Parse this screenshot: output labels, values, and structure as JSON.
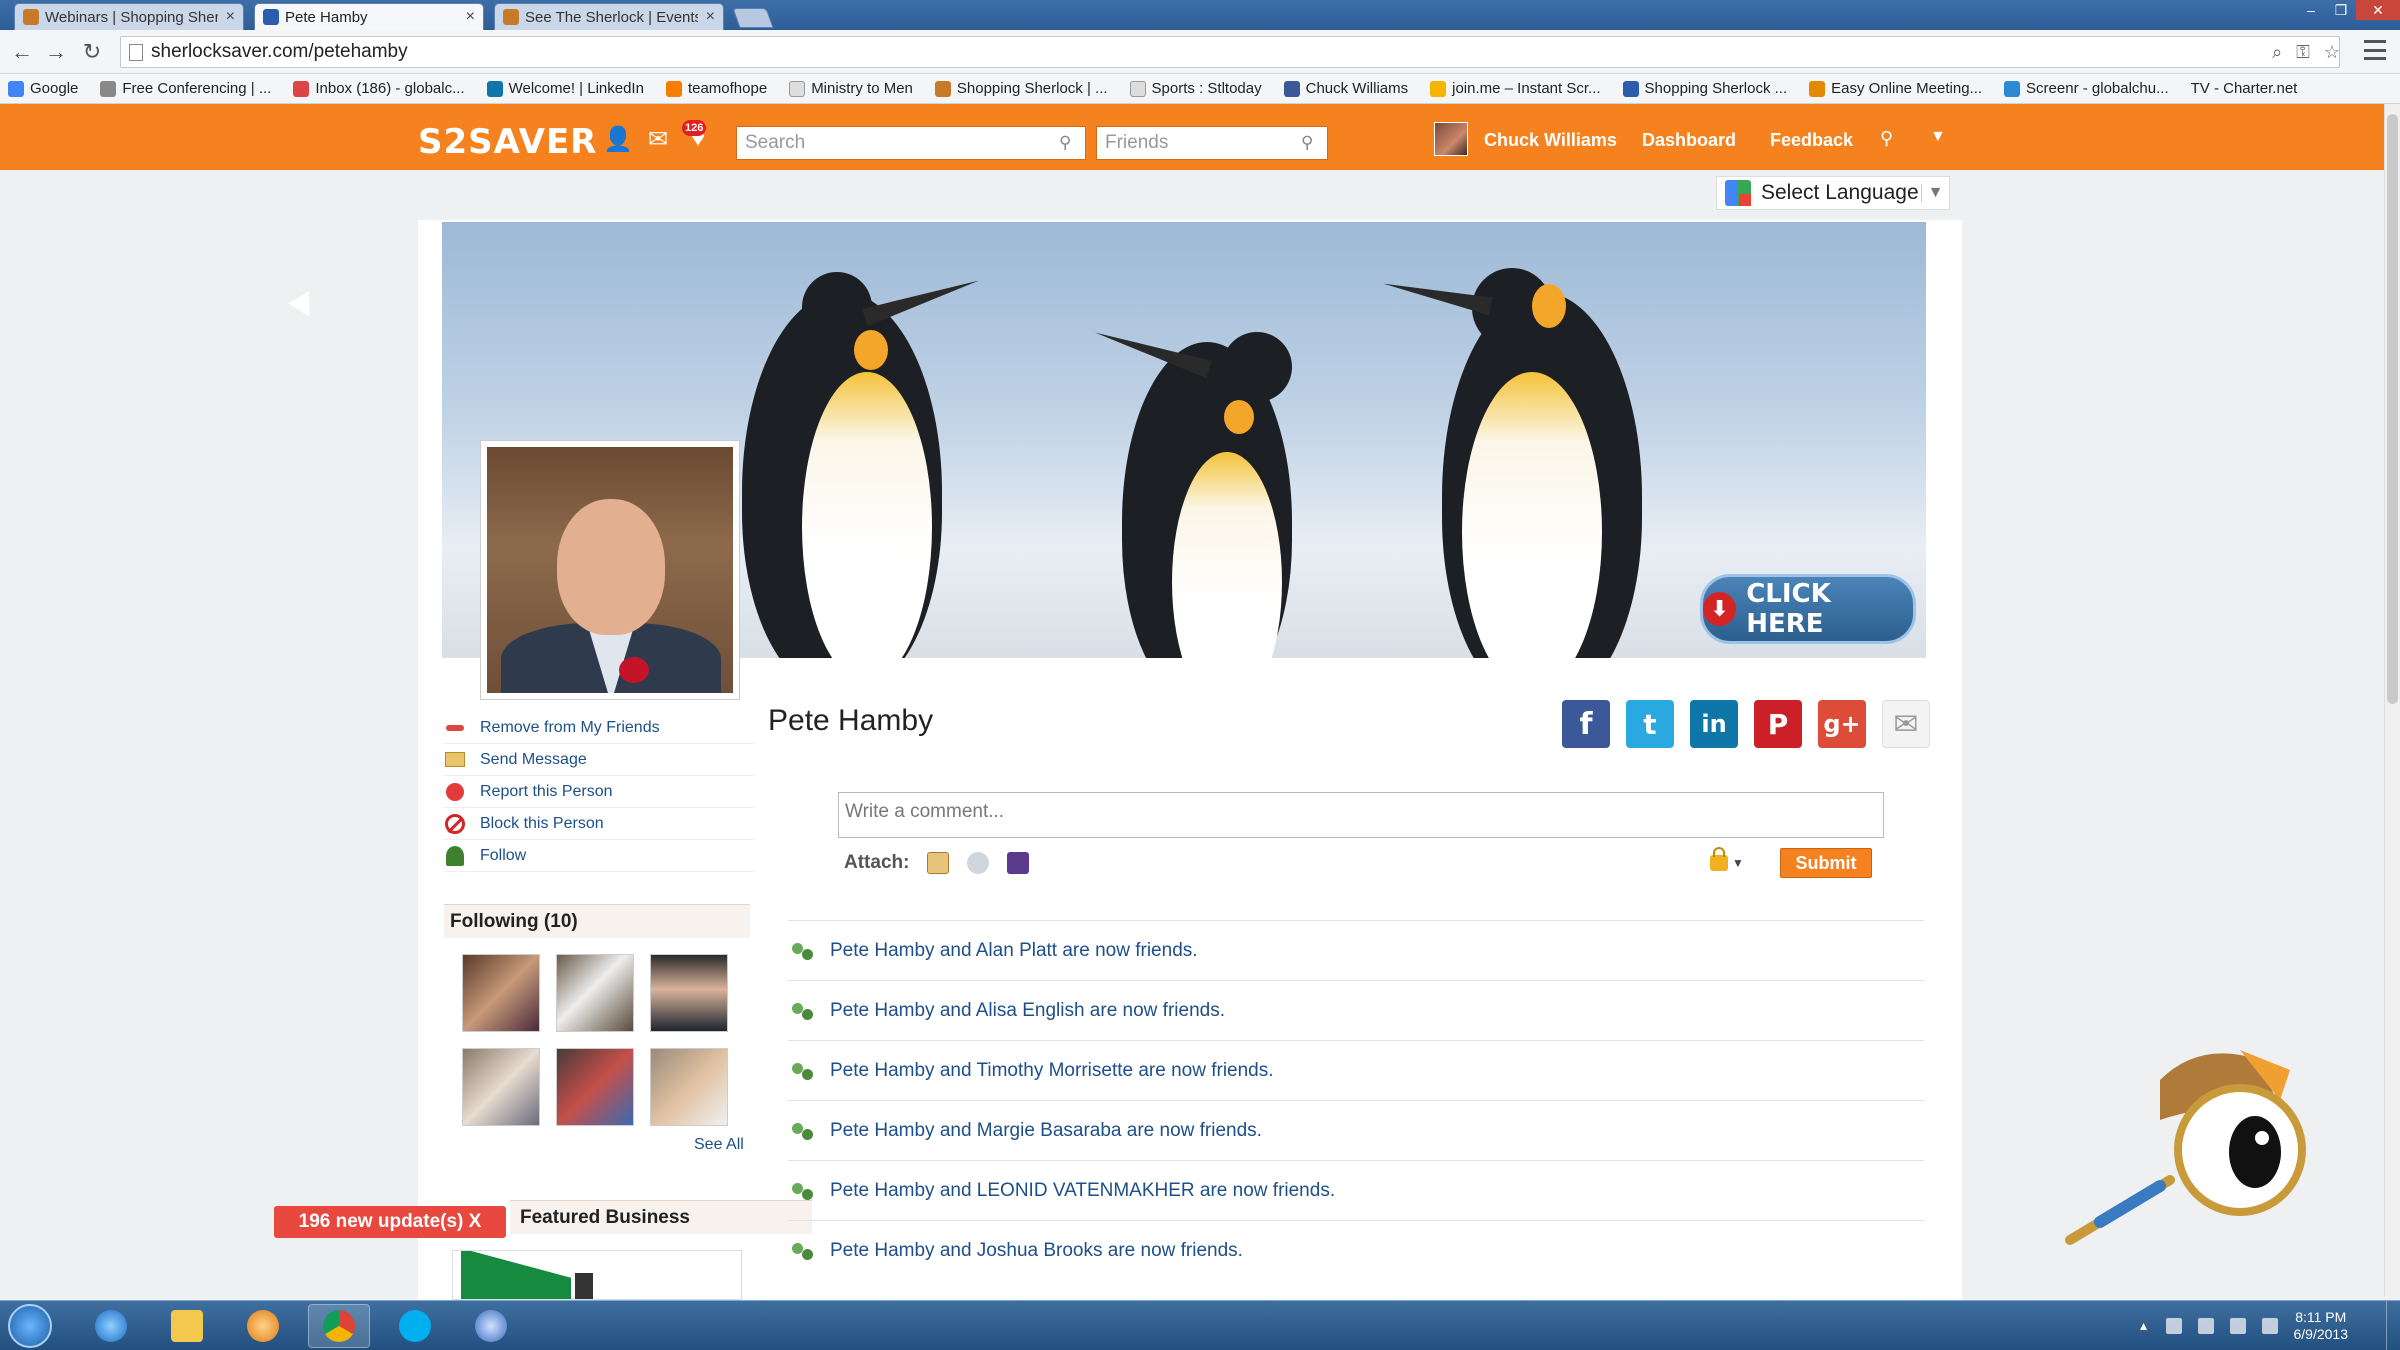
{
  "browser": {
    "tabs": [
      {
        "title": "Webinars | Shopping Sher",
        "active": false
      },
      {
        "title": "Pete Hamby",
        "active": true
      },
      {
        "title": "See The Sherlock | Events",
        "active": false
      }
    ],
    "tab_close": "×",
    "url": "sherlocksaver.com/petehamby",
    "bookmarks": [
      "Google",
      "Free Conferencing | ...",
      "Inbox (186) - globalc...",
      "Welcome! | LinkedIn",
      "teamofhope",
      "Ministry to Men",
      "Shopping Sherlock | ...",
      "Sports : Stltoday",
      "Chuck Williams",
      "join.me – Instant Scr...",
      "Shopping Sherlock ...",
      "Easy Online Meeting...",
      "Screenr - globalchu...",
      "TV - Charter.net"
    ]
  },
  "site_header": {
    "logo": "S2SAVER",
    "notification_count": "126",
    "search_placeholder": "Search",
    "friends_placeholder": "Friends",
    "user_name": "Chuck Williams",
    "dashboard": "Dashboard",
    "feedback": "Feedback"
  },
  "language": {
    "label": "Select Language"
  },
  "cover": {
    "click_here": "CLICK HERE"
  },
  "profile": {
    "name": "Pete Hamby",
    "actions": [
      "Remove from My Friends",
      "Send Message",
      "Report this Person",
      "Block this Person",
      "Follow"
    ],
    "following_title": "Following (10)",
    "see_all": "See All",
    "featured_title": "Featured Business",
    "updates_bar": "196 new update(s) X",
    "social": [
      "f",
      "t",
      "in",
      "P",
      "g+",
      "✉"
    ]
  },
  "composer": {
    "placeholder": "Write a comment...",
    "attach_label": "Attach:",
    "submit": "Submit"
  },
  "feed": [
    "Pete Hamby and Alan Platt are now friends.",
    "Pete Hamby and Alisa English are now friends.",
    "Pete Hamby and Timothy Morrisette are now friends.",
    "Pete Hamby and Margie Basaraba are now friends.",
    "Pete Hamby and LEONID VATENMAKHER are now friends.",
    "Pete Hamby and Joshua Brooks are now friends."
  ],
  "taskbar": {
    "time": "8:11 PM",
    "date": "6/9/2013"
  },
  "colors": {
    "brand_orange": "#f5821f",
    "link_blue": "#1d4f8a",
    "facebook": "#3b5998",
    "twitter": "#2aa9e0",
    "linkedin": "#0e76a8",
    "pinterest": "#cb2027",
    "googleplus": "#dd4b39"
  }
}
